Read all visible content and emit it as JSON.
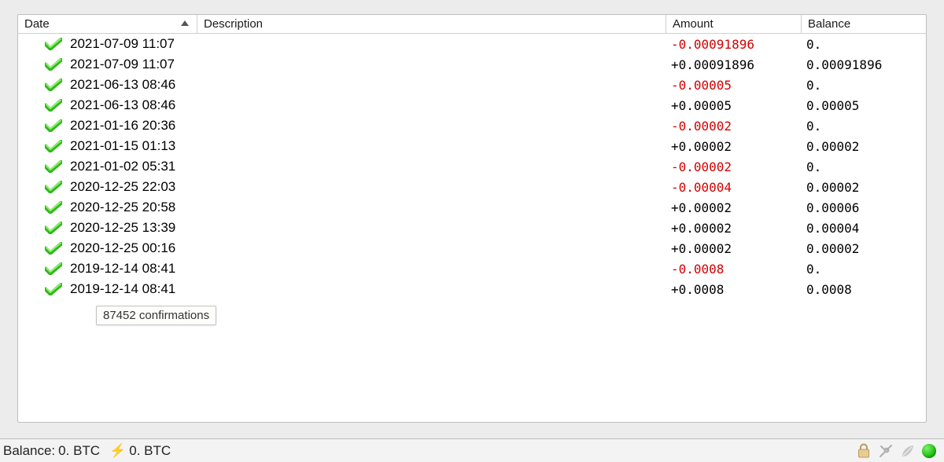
{
  "columns": {
    "date": "Date",
    "description": "Description",
    "amount": "Amount",
    "balance": "Balance"
  },
  "tooltip": "87452 confirmations",
  "transactions": [
    {
      "date": "2021-07-09 11:07",
      "description": "",
      "amount": "-0.00091896",
      "sign": "neg",
      "balance": "0."
    },
    {
      "date": "2021-07-09 11:07",
      "description": "",
      "amount": "+0.00091896",
      "sign": "pos",
      "balance": "0.00091896"
    },
    {
      "date": "2021-06-13 08:46",
      "description": "",
      "amount": "-0.00005",
      "sign": "neg",
      "balance": "0."
    },
    {
      "date": "2021-06-13 08:46",
      "description": "",
      "amount": "+0.00005",
      "sign": "pos",
      "balance": "0.00005"
    },
    {
      "date": "2021-01-16 20:36",
      "description": "",
      "amount": "-0.00002",
      "sign": "neg",
      "balance": "0."
    },
    {
      "date": "2021-01-15 01:13",
      "description": "",
      "amount": "+0.00002",
      "sign": "pos",
      "balance": "0.00002"
    },
    {
      "date": "2021-01-02 05:31",
      "description": "",
      "amount": "-0.00002",
      "sign": "neg",
      "balance": "0."
    },
    {
      "date": "2020-12-25 22:03",
      "description": "",
      "amount": "-0.00004",
      "sign": "neg",
      "balance": "0.00002"
    },
    {
      "date": "2020-12-25 20:58",
      "description": "",
      "amount": "+0.00002",
      "sign": "pos",
      "balance": "0.00006"
    },
    {
      "date": "2020-12-25 13:39",
      "description": "",
      "amount": "+0.00002",
      "sign": "pos",
      "balance": "0.00004"
    },
    {
      "date": "2020-12-25 00:16",
      "description": "",
      "amount": "+0.00002",
      "sign": "pos",
      "balance": "0.00002"
    },
    {
      "date": "2019-12-14 08:41",
      "description": "",
      "amount": "-0.0008",
      "sign": "neg",
      "balance": "0."
    },
    {
      "date": "2019-12-14 08:41",
      "description": "",
      "amount": "+0.0008",
      "sign": "pos",
      "balance": "0.0008"
    }
  ],
  "status": {
    "balance_label": "Balance:",
    "balance_value": "0. BTC",
    "lightning_value": "0. BTC"
  },
  "icons": {
    "check": "confirmed-check-icon",
    "lock": "lock-icon",
    "tools": "tools-icon",
    "seed": "seed-icon",
    "network": "network-status-icon"
  }
}
